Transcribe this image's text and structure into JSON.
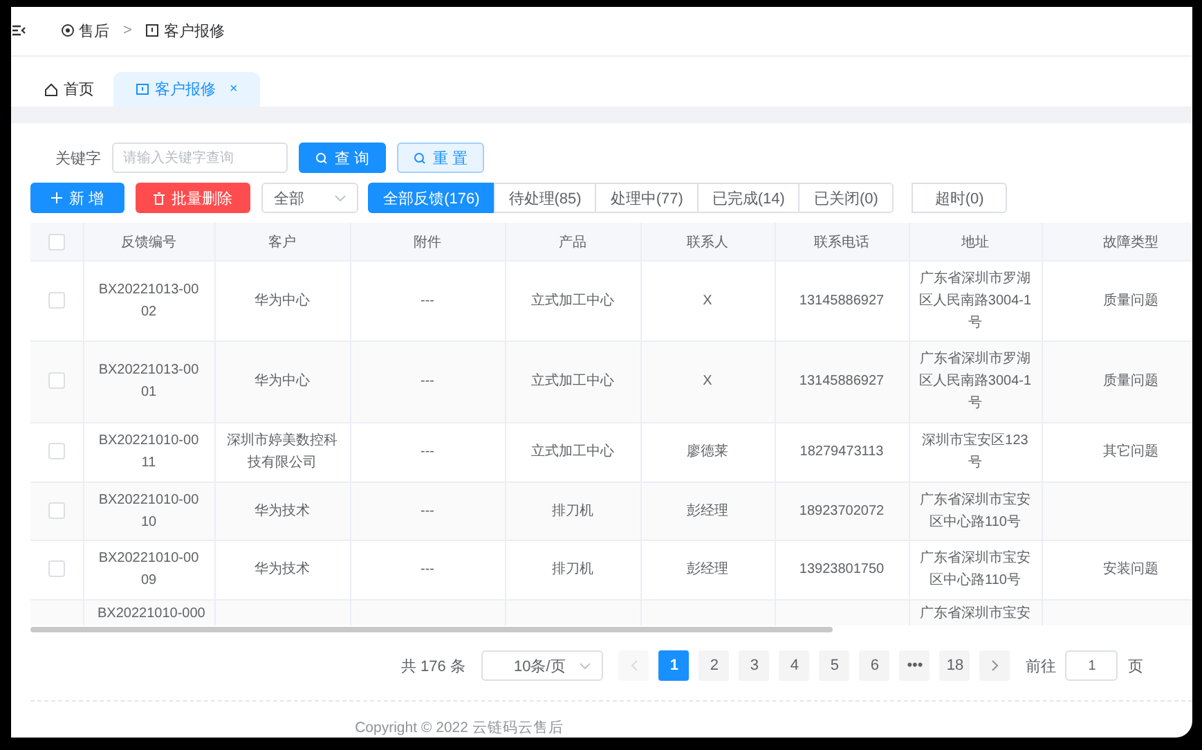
{
  "breadcrumb": {
    "items": [
      {
        "label": "售后"
      },
      {
        "label": "客户报修"
      }
    ],
    "separator": ">"
  },
  "tabs": [
    {
      "label": "首页",
      "selected": false,
      "closable": false
    },
    {
      "label": "客户报修",
      "selected": true,
      "closable": true,
      "close": "×"
    }
  ],
  "search": {
    "label": "关键字",
    "placeholder": "请输入关键字查询",
    "query_button": "查 询",
    "reset_button": "重 置"
  },
  "actions": {
    "add_button": "新 增",
    "batch_delete_button": "批量删除",
    "status_select": "全部"
  },
  "filters": [
    {
      "label": "全部反馈(176)",
      "selected": true
    },
    {
      "label": "待处理(85)",
      "selected": false
    },
    {
      "label": "处理中(77)",
      "selected": false
    },
    {
      "label": "已完成(14)",
      "selected": false
    },
    {
      "label": "已关闭(0)",
      "selected": false
    }
  ],
  "timeout_filter": {
    "label": "超时(0)",
    "selected": false
  },
  "table": {
    "columns": [
      "反馈编号",
      "客户",
      "附件",
      "产品",
      "联系人",
      "联系电话",
      "地址",
      "故障类型"
    ],
    "rows": [
      {
        "checked": false,
        "cells": [
          "BX20221013-0002",
          "华为中心",
          "---",
          "立式加工中心",
          "X",
          "13145886927",
          "广东省深圳市罗湖区人民南路3004-1号",
          "质量问题"
        ]
      },
      {
        "checked": false,
        "cells": [
          "BX20221013-0001",
          "华为中心",
          "---",
          "立式加工中心",
          "X",
          "13145886927",
          "广东省深圳市罗湖区人民南路3004-1号",
          "质量问题"
        ]
      },
      {
        "checked": false,
        "cells": [
          "BX20221010-0011",
          "深圳市婷美数控科技有限公司",
          "---",
          "立式加工中心",
          "廖德莱",
          "18279473113",
          "深圳市宝安区123号",
          "其它问题"
        ]
      },
      {
        "checked": false,
        "cells": [
          "BX20221010-0010",
          "华为技术",
          "---",
          "排刀机",
          "彭经理",
          "18923702072",
          "广东省深圳市宝安区中心路110号",
          ""
        ]
      },
      {
        "checked": false,
        "cells": [
          "BX20221010-0009",
          "华为技术",
          "---",
          "排刀机",
          "彭经理",
          "13923801750",
          "广东省深圳市宝安区中心路110号",
          "安装问题"
        ]
      },
      {
        "cells": [
          "BX20221010-000",
          "",
          "",
          "",
          "",
          "",
          "广东省深圳市宝安",
          ""
        ]
      }
    ],
    "all_checked": false
  },
  "pagination": {
    "total": "共 176 条",
    "page_size": "10条/页",
    "pages": [
      {
        "label": "1",
        "selected": true
      },
      {
        "label": "2",
        "selected": false
      },
      {
        "label": "3",
        "selected": false
      },
      {
        "label": "4",
        "selected": false
      },
      {
        "label": "5",
        "selected": false
      },
      {
        "label": "6",
        "selected": false
      },
      {
        "label": "•••",
        "selected": false
      },
      {
        "label": "18",
        "selected": false
      }
    ],
    "goto_label": "前往",
    "goto_value": "1",
    "goto_unit": "页"
  },
  "footer": "Copyright © 2022 云链码云售后"
}
